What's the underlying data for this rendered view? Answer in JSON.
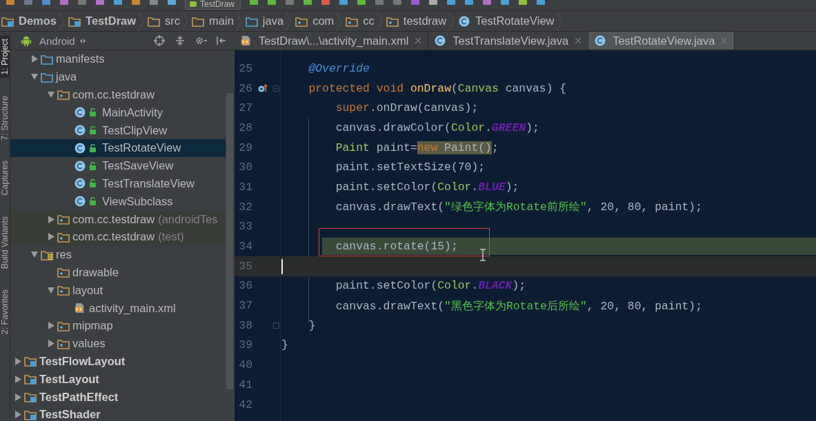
{
  "toolbar": {
    "run_config": "TestDraw"
  },
  "breadcrumbs": [
    {
      "label": "Demos",
      "kind": "module"
    },
    {
      "label": "TestDraw",
      "kind": "module"
    },
    {
      "label": "src",
      "kind": "folder"
    },
    {
      "label": "main",
      "kind": "folder"
    },
    {
      "label": "java",
      "kind": "source_folder"
    },
    {
      "label": "com",
      "kind": "package"
    },
    {
      "label": "cc",
      "kind": "package"
    },
    {
      "label": "testdraw",
      "kind": "package"
    },
    {
      "label": "TestRotateView",
      "kind": "class"
    }
  ],
  "tool_strip": [
    {
      "label": "1: Project",
      "selected": true
    },
    {
      "label": "7: Structure",
      "selected": false
    },
    {
      "label": "Captures",
      "selected": false
    },
    {
      "label": "Build Variants",
      "selected": false
    },
    {
      "label": "2: Favorites",
      "selected": false
    }
  ],
  "project_panel": {
    "view": "Android",
    "tree": [
      {
        "children": [
          {
            "label": "manifests",
            "kind": "source_folder",
            "expanded": false,
            "selected": false
          },
          {
            "label": "java",
            "kind": "source_folder",
            "expanded": true,
            "selected": false,
            "children": [
              {
                "label": "com.cc.testdraw",
                "kind": "package",
                "expanded": true,
                "selected": false,
                "children": [
                  {
                    "label": "MainActivity",
                    "kind": "class",
                    "selected": false
                  },
                  {
                    "label": "TestClipView",
                    "kind": "class",
                    "selected": false
                  },
                  {
                    "label": "TestRotateView",
                    "kind": "class",
                    "selected": true
                  },
                  {
                    "label": "TestSaveView",
                    "kind": "class",
                    "selected": false
                  },
                  {
                    "label": "TestTranslateView",
                    "kind": "class",
                    "selected": false
                  },
                  {
                    "label": "ViewSubclass",
                    "kind": "class",
                    "selected": false
                  }
                ]
              },
              {
                "label": "com.cc.testdraw",
                "note": "(androidTes",
                "kind": "test_package",
                "expanded": false,
                "selected": false
              },
              {
                "label": "com.cc.testdraw",
                "note": "(test)",
                "kind": "test_package",
                "expanded": false,
                "selected": false
              }
            ]
          },
          {
            "label": "res",
            "kind": "res_folder",
            "expanded": true,
            "selected": false,
            "children": [
              {
                "label": "drawable",
                "kind": "package",
                "selected": false
              },
              {
                "label": "layout",
                "kind": "package",
                "expanded": true,
                "selected": false,
                "children": [
                  {
                    "label": "activity_main.xml",
                    "kind": "xml_file",
                    "selected": false
                  }
                ]
              },
              {
                "label": "mipmap",
                "kind": "package",
                "expanded": false,
                "selected": false
              },
              {
                "label": "values",
                "kind": "package",
                "expanded": false,
                "selected": false
              }
            ]
          }
        ]
      },
      {
        "label": "TestFlowLayout",
        "kind": "module",
        "expanded": false,
        "selected": false
      },
      {
        "label": "TestLayout",
        "kind": "module",
        "expanded": false,
        "selected": false
      },
      {
        "label": "TestPathEffect",
        "kind": "module",
        "expanded": false,
        "selected": false
      },
      {
        "label": "TestShader",
        "kind": "module",
        "expanded": false,
        "selected": false
      }
    ]
  },
  "tabs": [
    {
      "label": "TestDraw\\...\\activity_main.xml",
      "kind": "xml_file",
      "selected": false
    },
    {
      "label": "TestTranslateView.java",
      "kind": "class",
      "selected": false
    },
    {
      "label": "TestRotateView.java",
      "kind": "class",
      "selected": true
    }
  ],
  "editor": {
    "lines": [
      {
        "number": "25",
        "indent": {
          "kind": "member"
        },
        "kind": "plain",
        "tokens": [
          {
            "kind": "annotation",
            "text": "@Override"
          }
        ]
      },
      {
        "number": "26",
        "indent": {
          "kind": "member"
        },
        "kind": "plain",
        "gutter": {
          "kind": "override"
        },
        "fold": {
          "kind": "start"
        },
        "tokens": [
          {
            "kind": "keyword",
            "text": "protected void"
          },
          {
            "kind": "method",
            "text": " onDraw"
          },
          {
            "kind": "plain",
            "text": "("
          },
          {
            "kind": "type",
            "text": "Canvas"
          },
          {
            "kind": "plain",
            "text": " canvas) {"
          }
        ]
      },
      {
        "number": "27",
        "indent": {
          "kind": "body"
        },
        "kind": "plain",
        "tokens": [
          {
            "kind": "keyword",
            "text": "super"
          },
          {
            "kind": "plain",
            "text": ".onDraw(canvas);"
          }
        ]
      },
      {
        "number": "28",
        "indent": {
          "kind": "body"
        },
        "kind": "plain",
        "tokens": [
          {
            "kind": "plain",
            "text": "canvas.drawColor("
          },
          {
            "kind": "type",
            "text": "Color."
          },
          {
            "kind": "constant",
            "text": "GREEN"
          },
          {
            "kind": "plain",
            "text": ");"
          }
        ]
      },
      {
        "number": "29",
        "indent": {
          "kind": "body"
        },
        "kind": "plain",
        "tokens": [
          {
            "kind": "type",
            "text": "Paint"
          },
          {
            "kind": "plain",
            "text": " paint="
          },
          {
            "kind": "match",
            "tokens": [
              {
                "kind": "keyword",
                "text": "new"
              },
              {
                "kind": "plain",
                "text": " Paint()"
              }
            ]
          },
          {
            "kind": "plain",
            "text": ";"
          }
        ]
      },
      {
        "number": "30",
        "indent": {
          "kind": "body"
        },
        "kind": "plain",
        "tokens": [
          {
            "kind": "plain",
            "text": "paint.setTextSize(70);"
          }
        ]
      },
      {
        "number": "31",
        "indent": {
          "kind": "body"
        },
        "kind": "plain",
        "tokens": [
          {
            "kind": "plain",
            "text": "paint.setColor("
          },
          {
            "kind": "type",
            "text": "Color."
          },
          {
            "kind": "constant",
            "text": "BLUE"
          },
          {
            "kind": "plain",
            "text": ");"
          }
        ]
      },
      {
        "number": "32",
        "indent": {
          "kind": "body"
        },
        "kind": "plain",
        "tokens": [
          {
            "kind": "plain",
            "text": "canvas.drawText("
          },
          {
            "kind": "string",
            "text": "\"绿色字体为Rotate前所绘\""
          },
          {
            "kind": "plain",
            "text": ", 20, 80, paint);"
          }
        ]
      },
      {
        "number": "33",
        "kind": "plain"
      },
      {
        "number": "34",
        "indent": {
          "kind": "body"
        },
        "kind": "highlighted",
        "annotation": {
          "kind": "rectangle"
        },
        "pointer": {
          "kind": "ibeam"
        },
        "tokens": [
          {
            "kind": "plain",
            "text": "canvas.rotate(15);"
          }
        ]
      },
      {
        "number": "35",
        "kind": "current"
      },
      {
        "number": "36",
        "indent": {
          "kind": "body"
        },
        "kind": "plain",
        "tokens": [
          {
            "kind": "plain",
            "text": "paint.setColor("
          },
          {
            "kind": "type",
            "text": "Color."
          },
          {
            "kind": "constant",
            "text": "BLACK"
          },
          {
            "kind": "plain",
            "text": ");"
          }
        ]
      },
      {
        "number": "37",
        "indent": {
          "kind": "body"
        },
        "kind": "plain",
        "tokens": [
          {
            "kind": "plain",
            "text": "canvas.drawText("
          },
          {
            "kind": "string",
            "text": "\"黑色字体为Rotate后所绘\""
          },
          {
            "kind": "plain",
            "text": ", 20, 80, paint);"
          }
        ]
      },
      {
        "number": "38",
        "indent": {
          "kind": "member"
        },
        "kind": "plain",
        "fold": {
          "kind": "end"
        },
        "tokens": [
          {
            "kind": "plain",
            "text": "}"
          }
        ]
      },
      {
        "number": "39",
        "kind": "plain",
        "tokens": [
          {
            "kind": "plain",
            "text": "}"
          }
        ]
      },
      {
        "number": "40",
        "kind": "plain"
      },
      {
        "number": "41",
        "kind": "plain"
      },
      {
        "number": "42",
        "kind": "plain"
      }
    ]
  }
}
